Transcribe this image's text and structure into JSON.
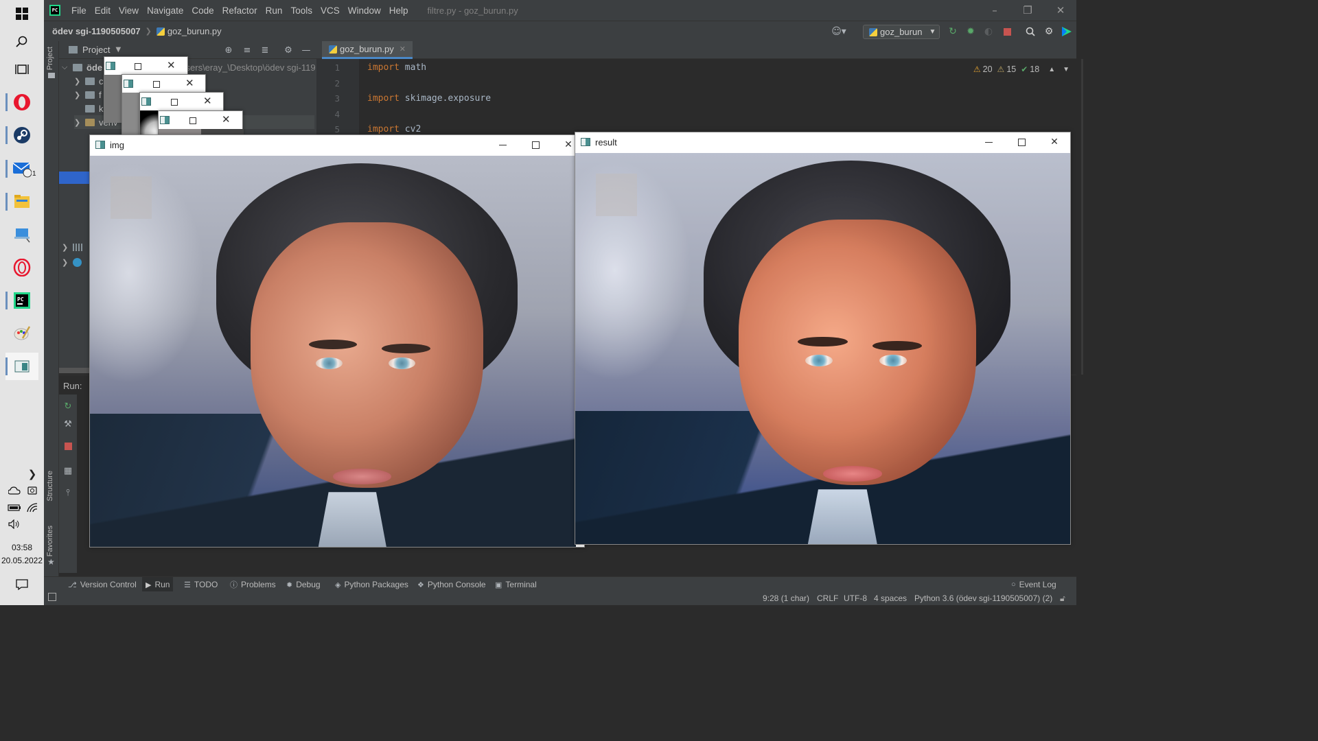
{
  "taskbar": {
    "icons": [
      "windows-start-icon",
      "search-icon",
      "task-view-icon",
      "opera-icon",
      "steam-icon",
      "mail-icon",
      "file-explorer-icon",
      "network-computer-icon",
      "opera-gx-icon",
      "pycharm-icon",
      "paint-icon",
      "python-window-icon"
    ],
    "mail_badge": "1",
    "clock_time": "03:58",
    "clock_date": "20.05.2022"
  },
  "menubar": {
    "items": [
      "File",
      "Edit",
      "View",
      "Navigate",
      "Code",
      "Refactor",
      "Run",
      "Tools",
      "VCS",
      "Window",
      "Help"
    ],
    "window_title": "filtre.py - goz_burun.py"
  },
  "navbar": {
    "project": "ödev sgi-1190505007",
    "file": "goz_burun.py",
    "run_config": "goz_burun"
  },
  "project_panel": {
    "title": "Project",
    "path_text": "Users\\eray_\\Desktop\\ödev sgi-119",
    "root_label": "öde",
    "rows": [
      "c",
      "f",
      "k",
      "venv"
    ]
  },
  "left_strip": {
    "project_label": "Project",
    "structure_label": "Structure",
    "favorites_label": "Favorites"
  },
  "editor": {
    "tab": "goz_burun.py",
    "lines": [
      {
        "num": "1",
        "kw": "import",
        "rest": " math"
      },
      {
        "num": "2",
        "kw": "",
        "rest": ""
      },
      {
        "num": "3",
        "kw": "import",
        "rest": " skimage.exposure"
      },
      {
        "num": "4",
        "kw": "",
        "rest": ""
      },
      {
        "num": "5",
        "kw": "import",
        "rest": " cv2"
      }
    ],
    "inspections": {
      "warnings": "20",
      "weak_warnings": "15",
      "ok": "18"
    }
  },
  "run_panel": {
    "label": "Run:"
  },
  "bottom_tools": {
    "items": [
      "Version Control",
      "Run",
      "TODO",
      "Problems",
      "Debug",
      "Python Packages",
      "Python Console",
      "Terminal"
    ],
    "event_log": "Event Log"
  },
  "statusbar": {
    "position": "9:28 (1 char)",
    "line_sep": "CRLF",
    "encoding": "UTF-8",
    "indent": "4 spaces",
    "interpreter": "Python 3.6 (ödev sgi-1190505007) (2)"
  },
  "cv_windows": {
    "img_title": "img",
    "result_title": "result"
  }
}
